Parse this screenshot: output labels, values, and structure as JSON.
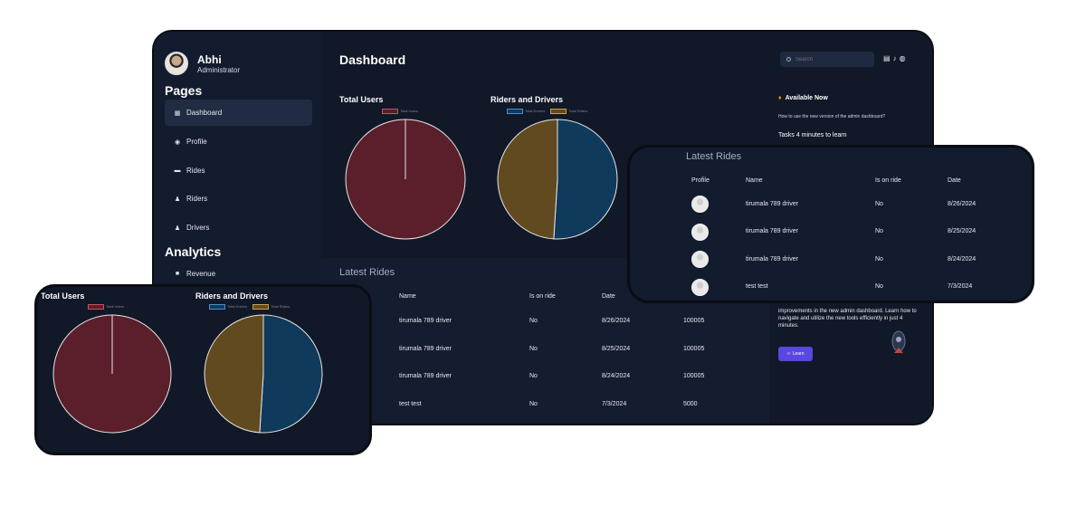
{
  "profile": {
    "name": "Abhi",
    "role": "Administrator"
  },
  "sidebar": {
    "pages_heading": "Pages",
    "items": [
      {
        "label": "Dashboard",
        "icon": "grid-icon"
      },
      {
        "label": "Profile",
        "icon": "user-circle-icon"
      },
      {
        "label": "Rides",
        "icon": "car-icon"
      },
      {
        "label": "Riders",
        "icon": "person-icon"
      },
      {
        "label": "Drivers",
        "icon": "person-icon"
      }
    ],
    "analytics_heading": "Analytics",
    "analytics_items": [
      {
        "label": "Revenue",
        "icon": "briefcase-icon"
      }
    ]
  },
  "header": {
    "title": "Dashboard",
    "search_placeholder": "Search"
  },
  "charts": {
    "total_users_title": "Total Users",
    "riders_drivers_title": "Riders and Drivers"
  },
  "chart_data": [
    {
      "type": "pie",
      "title": "Total Users",
      "labels": [
        "Total Users"
      ],
      "values": [
        1
      ],
      "colors": [
        "#5a1f2b"
      ]
    },
    {
      "type": "pie",
      "title": "Riders and Drivers",
      "labels": [
        "Total Drivers",
        "Total Riders"
      ],
      "values": [
        51,
        49
      ],
      "colors": [
        "#0f3a5c",
        "#614a1f"
      ]
    }
  ],
  "latest_rides": {
    "title": "Latest Rides",
    "columns": [
      "Name",
      "Is on ride",
      "Date"
    ],
    "rows": [
      {
        "name": "tirumala 789 driver",
        "on_ride": "No",
        "date": "8/26/2024",
        "amount": "100005"
      },
      {
        "name": "tirumala 789 driver",
        "on_ride": "No",
        "date": "8/25/2024",
        "amount": "100005"
      },
      {
        "name": "tirumala 789 driver",
        "on_ride": "No",
        "date": "8/24/2024",
        "amount": "100005"
      },
      {
        "name": "test test",
        "on_ride": "No",
        "date": "7/3/2024",
        "amount": "5000"
      }
    ]
  },
  "latest_rides_popup": {
    "title": "Latest Rides",
    "columns": [
      "Profile",
      "Name",
      "Is on ride",
      "Date"
    ],
    "rows": [
      {
        "name": "tirumala 789 driver",
        "on_ride": "No",
        "date": "8/26/2024"
      },
      {
        "name": "tirumala 789 driver",
        "on_ride": "No",
        "date": "8/25/2024"
      },
      {
        "name": "tirumala 789 driver",
        "on_ride": "No",
        "date": "8/24/2024"
      },
      {
        "name": "test test",
        "on_ride": "No",
        "date": "7/3/2024"
      }
    ]
  },
  "available": {
    "heading": "Available Now",
    "question": "How to use the new version of the admin dashboard?",
    "tasks": "Tasks 4 minutes to learn",
    "description": "improvements in the new admin dashboard. Learn how to navigate and utilize the new tools efficiently in just 4 minutes.",
    "button": "Learn"
  }
}
